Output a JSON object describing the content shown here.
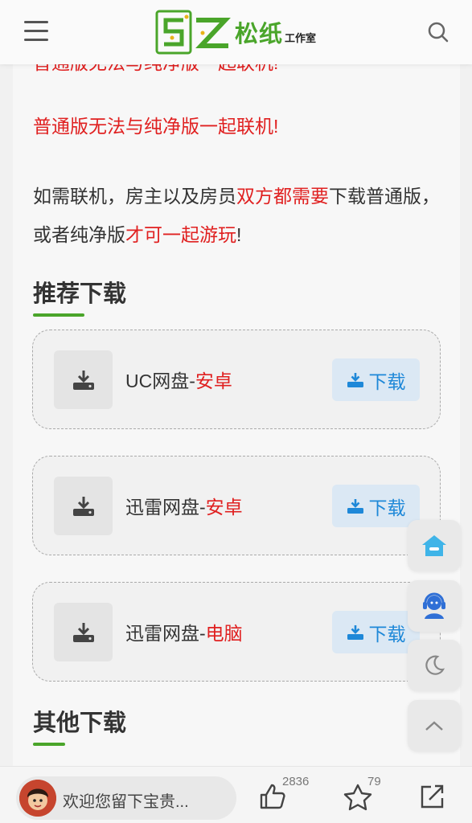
{
  "header": {
    "logo_text": "松纸",
    "logo_sub": "工作室",
    "logo_mark_letters": "SZ"
  },
  "content": {
    "cut_line": "普通版无法与纯净版一起联机!",
    "p1_red": "普通版无法与纯净版一起联机!",
    "p2_a": "如需联机，房主以及房员",
    "p2_red1": "双方都需要",
    "p2_b": "下载普通版，或者纯净版",
    "p2_red2": "才可一起游玩",
    "p2_c": "!"
  },
  "recommend": {
    "title": "推荐下载",
    "items": [
      {
        "name": "UC网盘-",
        "tag": "安卓",
        "button": "下载"
      },
      {
        "name": "迅雷网盘-",
        "tag": "安卓",
        "button": "下载"
      },
      {
        "name": "迅雷网盘-",
        "tag": "电脑",
        "button": "下载"
      }
    ]
  },
  "other": {
    "title": "其他下载"
  },
  "bottom": {
    "comment_placeholder": "欢迎您留下宝贵...",
    "like_count": "2836",
    "star_count": "79"
  },
  "colors": {
    "accent_green": "#4aa52a",
    "accent_red": "#e02020",
    "accent_blue": "#1e88d8",
    "float_icon_blue": "#3fb4e8"
  }
}
